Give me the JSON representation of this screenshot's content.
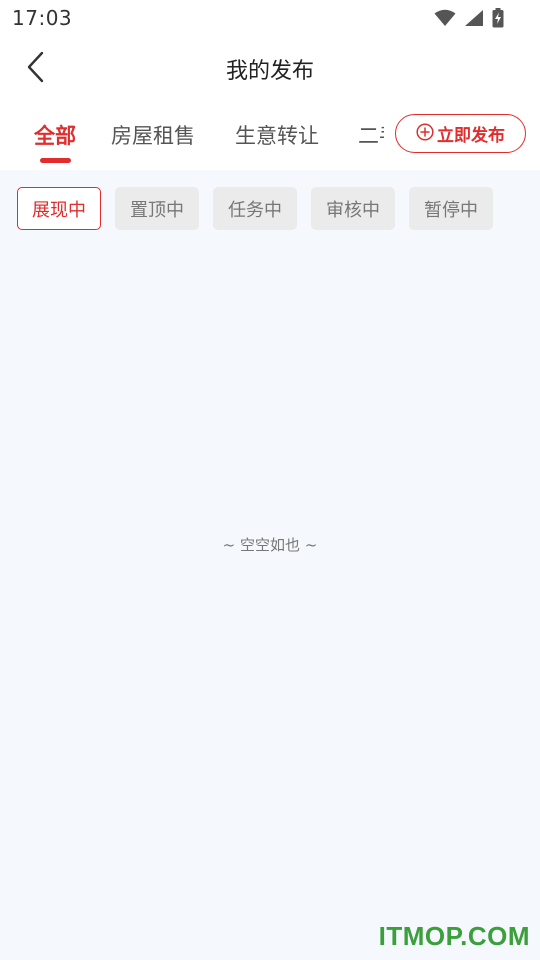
{
  "status_bar": {
    "time": "17:03",
    "icons": [
      "wifi-icon",
      "cell-signal-icon",
      "battery-charging-icon"
    ]
  },
  "header": {
    "back_icon": "chevron-left-icon",
    "title": "我的发布"
  },
  "tabs": {
    "items": [
      {
        "label": "全部",
        "active": true
      },
      {
        "label": "房屋租售",
        "active": false
      },
      {
        "label": "生意转让",
        "active": false
      },
      {
        "label": "二手",
        "active": false
      }
    ],
    "publish_button": {
      "label": "立即发布",
      "icon": "plus-circle-icon"
    }
  },
  "filters": {
    "items": [
      {
        "label": "展现中",
        "active": true
      },
      {
        "label": "置顶中",
        "active": false
      },
      {
        "label": "任务中",
        "active": false
      },
      {
        "label": "审核中",
        "active": false
      },
      {
        "label": "暂停中",
        "active": false
      }
    ]
  },
  "empty_state": {
    "text": "~ 空空如也 ~"
  },
  "watermark": {
    "text": "ITMOP.COM"
  },
  "colors": {
    "accent": "#e12d2d",
    "background": "#f5f8fd",
    "chip_inactive_bg": "#ebebeb",
    "watermark": "#3ba03b"
  }
}
